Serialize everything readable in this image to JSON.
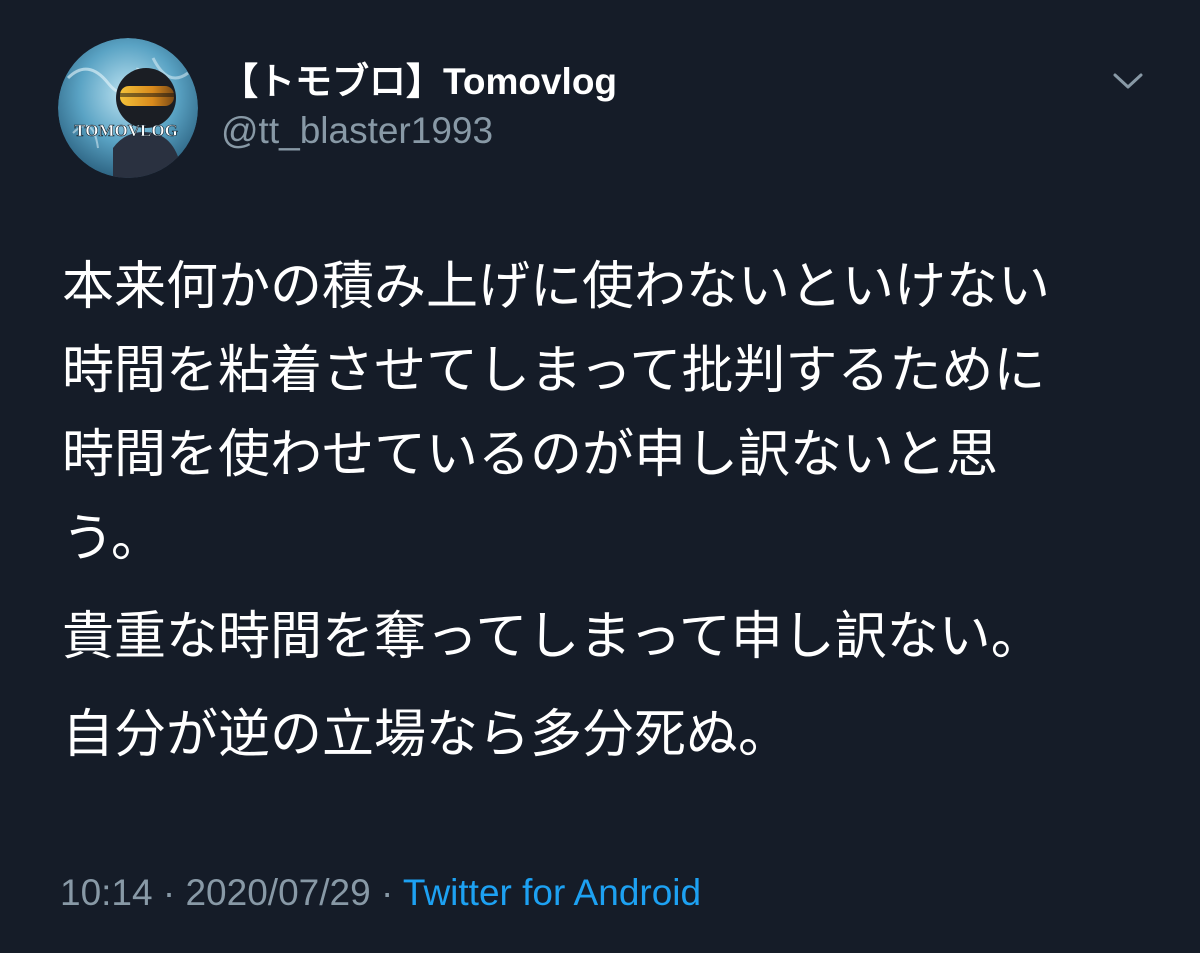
{
  "user": {
    "display_name": "【トモブロ】Tomovlog",
    "handle": "@tt_blaster1993",
    "avatar_text": "TOMOVLOG"
  },
  "icons": {
    "menu": "chevron-down-icon"
  },
  "tweet": {
    "paragraphs": [
      "本来何かの積み上げに使わないといけない\n時間を粘着させてしまって批判するために\n時間を使わせているのが申し訳ないと思\nう。",
      "貴重な時間を奪ってしまって申し訳ない。",
      "自分が逆の立場なら多分死ぬ。"
    ],
    "time": "10:14",
    "separator": "·",
    "date": "2020/07/29",
    "source": "Twitter for Android"
  },
  "colors": {
    "background": "#151c28",
    "text": "#ffffff",
    "secondary": "#8899a6",
    "link": "#1da1f2"
  }
}
